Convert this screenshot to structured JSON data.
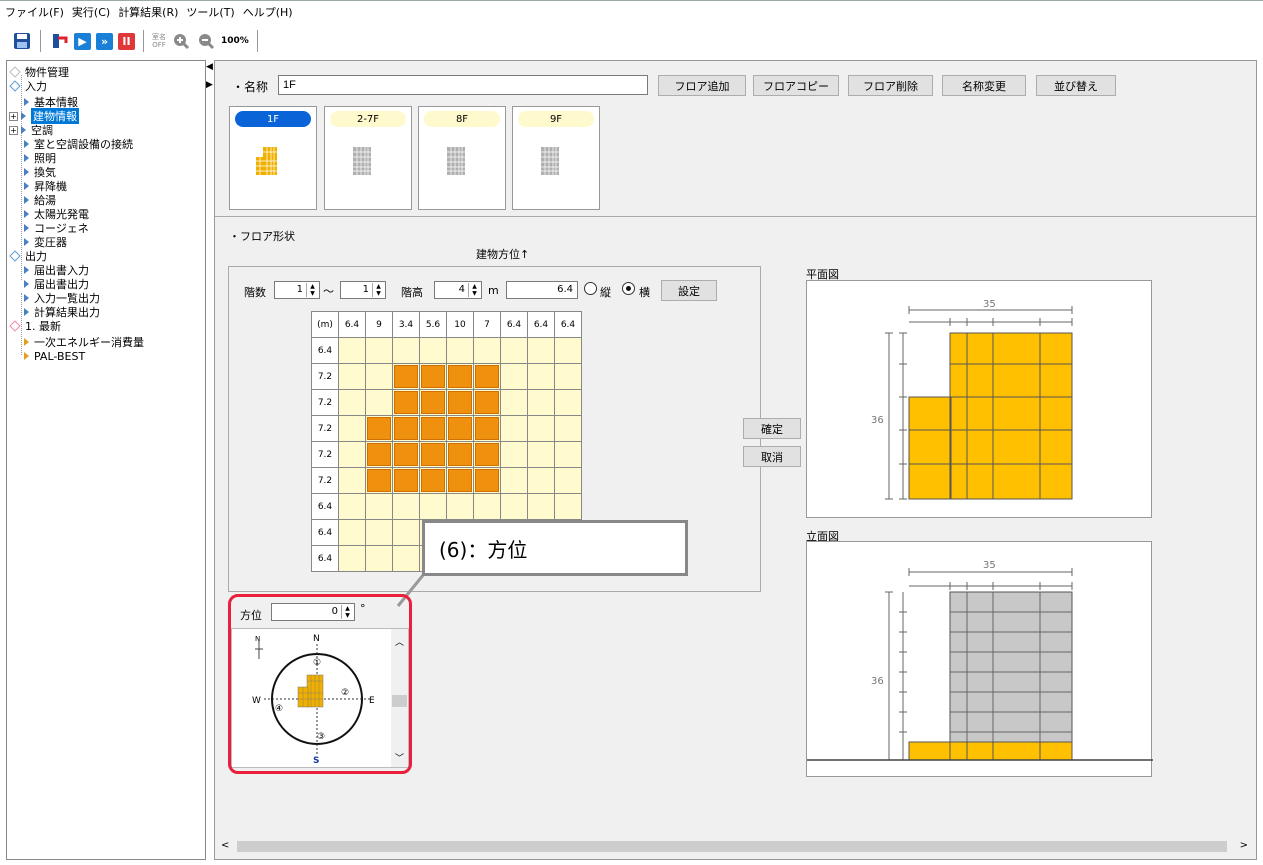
{
  "menu": [
    "ファイル(F)",
    "実行(C)",
    "計算結果(R)",
    "ツール(T)",
    "ヘルプ(H)"
  ],
  "toolbar": {
    "save_icon": "save-icon",
    "undo_icon": "undo-icon",
    "play_icon": "play-icon",
    "forward_icon": "fast-forward-icon",
    "stop_icon": "stop-icon",
    "toggle_top": "室名",
    "toggle_bottom": "OFF",
    "zoom_in_icon": "zoom-in-icon",
    "zoom_out_icon": "zoom-out-icon",
    "zoom_label": "100%"
  },
  "tree": {
    "items": [
      {
        "label": "物件管理"
      },
      {
        "label": "入力"
      },
      {
        "label": "基本情報"
      },
      {
        "label": "建物情報"
      },
      {
        "label": "空調"
      },
      {
        "label": "室と空調設備の接続"
      },
      {
        "label": "照明"
      },
      {
        "label": "換気"
      },
      {
        "label": "昇降機"
      },
      {
        "label": "給湯"
      },
      {
        "label": "太陽光発電"
      },
      {
        "label": "コージェネ"
      },
      {
        "label": "変圧器"
      },
      {
        "label": "出力"
      },
      {
        "label": "届出書入力"
      },
      {
        "label": "届出書出力"
      },
      {
        "label": "入力一覧出力"
      },
      {
        "label": "計算結果出力"
      },
      {
        "label": "1. 最新"
      },
      {
        "label": "一次エネルギー消費量"
      },
      {
        "label": "PAL-BEST"
      }
    ]
  },
  "name_section": {
    "label": "・名称",
    "value": "1F",
    "buttons": [
      "フロア追加",
      "フロアコピー",
      "フロア削除",
      "名称変更",
      "並び替え"
    ]
  },
  "floors": [
    {
      "label": "1F",
      "active": true
    },
    {
      "label": "2-7F",
      "active": false
    },
    {
      "label": "8F",
      "active": false
    },
    {
      "label": "9F",
      "active": false
    }
  ],
  "floor_shape": {
    "section_label": "・フロア形状",
    "orientation_label": "建物方位↑",
    "floors_label": "階数",
    "floor_from": "1",
    "tilde": "～",
    "floor_to": "1",
    "height_label": "階高",
    "height_value": "4",
    "height_unit": "m",
    "size_value": "6.4",
    "radio_vertical": "縦",
    "radio_horizontal": "横",
    "set_button": "設定",
    "confirm_button": "確定",
    "cancel_button": "取消"
  },
  "grid": {
    "corner": "(m)",
    "col_headers": [
      "6.4",
      "9",
      "3.4",
      "5.6",
      "10",
      "7",
      "6.4",
      "6.4",
      "6.4"
    ],
    "row_headers": [
      "6.4",
      "7.2",
      "7.2",
      "7.2",
      "7.2",
      "7.2",
      "6.4",
      "6.4",
      "6.4"
    ],
    "filled": [
      [
        0,
        0,
        0,
        0,
        0,
        0,
        0,
        0,
        0
      ],
      [
        0,
        0,
        1,
        1,
        1,
        1,
        0,
        0,
        0
      ],
      [
        0,
        0,
        1,
        1,
        1,
        1,
        0,
        0,
        0
      ],
      [
        0,
        1,
        1,
        1,
        1,
        1,
        0,
        0,
        0
      ],
      [
        0,
        1,
        1,
        1,
        1,
        1,
        0,
        0,
        0
      ],
      [
        0,
        1,
        1,
        1,
        1,
        1,
        0,
        0,
        0
      ],
      [
        0,
        0,
        0,
        0,
        0,
        0,
        0,
        0,
        0
      ],
      [
        0,
        0,
        0,
        0,
        0,
        0,
        0,
        0,
        0
      ],
      [
        0,
        0,
        0,
        0,
        0,
        0,
        0,
        0,
        0
      ]
    ]
  },
  "plan_view": {
    "title": "平面図",
    "width_label": "35",
    "height_label": "36"
  },
  "elevation_view": {
    "title": "立面図",
    "width_label": "35",
    "height_label": "36"
  },
  "azimuth": {
    "label": "方位",
    "value": "0",
    "unit": "°",
    "compass": {
      "n": "N",
      "s": "S",
      "e": "E",
      "w": "W",
      "n_small": "N",
      "m1": "①",
      "m2": "②",
      "m3": "③",
      "m4": "④"
    }
  },
  "callout": {
    "text": "(6)：方位"
  },
  "colors": {
    "accent": "#0a64d8",
    "fill": "#f0900f",
    "plan_fill": "#ffc000",
    "elev_gray": "#c8c8c8",
    "highlight": "#e8203c"
  }
}
